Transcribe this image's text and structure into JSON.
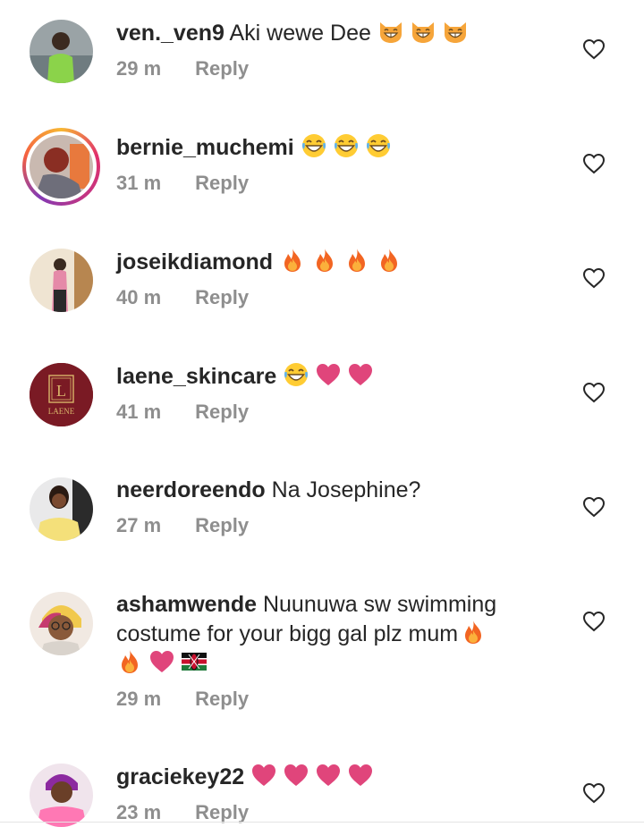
{
  "comments": [
    {
      "username": "ven._ven9",
      "text": "Aki wewe Dee",
      "emojis": [
        "grinning-cat",
        "grinning-cat",
        "grinning-cat"
      ],
      "time": "29 m",
      "reply": "Reply",
      "avatar": "person-photo-green"
    },
    {
      "username": "bernie_muchemi",
      "text": "",
      "emojis": [
        "laughing-face",
        "laughing-face",
        "laughing-face"
      ],
      "time": "31 m",
      "reply": "Reply",
      "avatar": "person-photo-story-ring"
    },
    {
      "username": "joseikdiamond",
      "text": "",
      "emojis": [
        "fire",
        "fire",
        "fire",
        "fire"
      ],
      "time": "40 m",
      "reply": "Reply",
      "avatar": "person-photo-beige"
    },
    {
      "username": "laene_skincare",
      "text": "",
      "emojis": [
        "laughing-face",
        "pink-heart",
        "pink-heart"
      ],
      "time": "41 m",
      "reply": "Reply",
      "avatar": "laene-logo",
      "logo_letter": "L",
      "logo_text": "LAENE"
    },
    {
      "username": "neerdoreendo",
      "text": "Na Josephine?",
      "emojis": [],
      "time": "27 m",
      "reply": "Reply",
      "avatar": "person-photo-yellow"
    },
    {
      "username": "ashamwende",
      "text_line1": "Nuunuwa sw swimming",
      "text_line2": "costume for your bigg gal plz mum",
      "emojis_line2": [
        "fire"
      ],
      "emojis_line3": [
        "fire",
        "pink-heart",
        "kenya-flag"
      ],
      "time": "29 m",
      "reply": "Reply",
      "avatar": "person-photo-glasses"
    },
    {
      "username": "graciekey22",
      "text": "",
      "emojis": [
        "pink-heart",
        "pink-heart",
        "pink-heart",
        "pink-heart"
      ],
      "time": "23 m",
      "reply": "Reply",
      "avatar": "person-photo-pink"
    }
  ],
  "icons": {
    "like": "heart-outline-icon"
  },
  "colors": {
    "meta": "#8e8e8e",
    "text": "#262626",
    "heart_emoji": "#e0457b",
    "laene_bg": "#7a1a24",
    "laene_gold": "#d8b46a"
  }
}
